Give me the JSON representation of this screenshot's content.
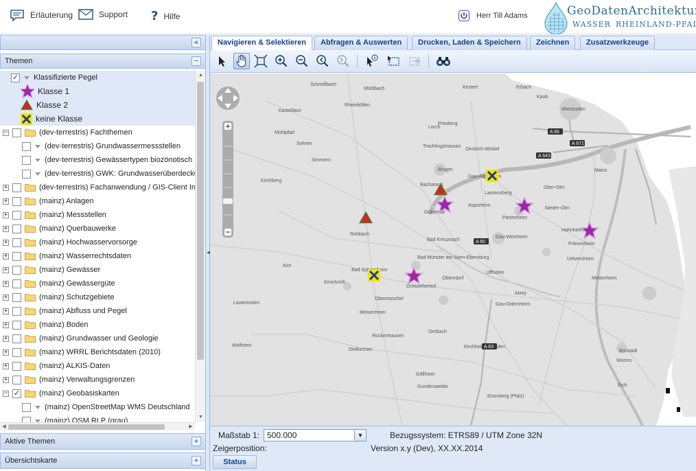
{
  "header": {
    "links": [
      {
        "label": "Erläuterung",
        "icon": "comment-icon"
      },
      {
        "label": "Support",
        "icon": "mail-icon"
      },
      {
        "label": "Hilfe",
        "icon": "help-icon"
      }
    ],
    "user": "Herr Till Adams",
    "logo": {
      "line1": "GeoDatenArchitektur",
      "line2": "Wasser",
      "line3": "Rheinland-Pfalz"
    }
  },
  "left": {
    "collapse_glyph": "«",
    "themes_title": "Themen",
    "themes_tool": "−",
    "active_title": "Aktive Themen",
    "overview_title": "Übersichtskarte",
    "expand_glyph": "+"
  },
  "tree": [
    {
      "label": "Klassifizierte Pegel",
      "checked": true
    },
    {
      "label": "Klasse 1"
    },
    {
      "label": "Klasse 2"
    },
    {
      "label": "keine Klasse"
    },
    {
      "label": "(dev-terrestris) Fachthemen"
    },
    {
      "label": "(dev-terrestris) Grundwassermessstellen"
    },
    {
      "label": "(dev-terrestris) Gewässertypen biozönotisch"
    },
    {
      "label": "(dev-terrestris) GWK: Grundwasserüberdeckung"
    },
    {
      "label": "(dev-terrestris) Fachanwendung / GIS-Client Int"
    },
    {
      "label": "(mainz) Anlagen"
    },
    {
      "label": "(mainz) Messstellen"
    },
    {
      "label": "(mainz) Querbauwerke"
    },
    {
      "label": "(mainz) Hochwasservorsorge"
    },
    {
      "label": "(mainz) Wasserrechtsdaten"
    },
    {
      "label": "(mainz) Gewässer"
    },
    {
      "label": "(mainz) Gewässergüte"
    },
    {
      "label": "(mainz) Schutzgebiete"
    },
    {
      "label": "(mainz) Abfluss und Pegel"
    },
    {
      "label": "(mainz) Boden"
    },
    {
      "label": "(mainz) Grundwasser und Geologie"
    },
    {
      "label": "(mainz) WRRL Berichtsdaten (2010)"
    },
    {
      "label": "(mainz) ALKIS-Daten"
    },
    {
      "label": "(mainz) Verwaltungsgrenzen"
    },
    {
      "label": "(mainz) Geobasiskarten",
      "checked": true
    },
    {
      "label": "(mainz) OpenStreetMap WMS Deutschland"
    },
    {
      "label": "(mainz) OSM RLP (grau)"
    }
  ],
  "tabs": [
    {
      "label": "Navigieren & Selektieren",
      "active": true
    },
    {
      "label": "Abfragen & Auswerten"
    },
    {
      "label": "Drucken, Laden & Speichern"
    },
    {
      "label": "Zeichnen"
    },
    {
      "label": "Zusatzwerkzeuge"
    }
  ],
  "map": {
    "places": [
      "Schnellbach",
      "Mühlbach",
      "Kestert",
      "Erbach",
      "Kaub",
      "Kastellaun",
      "Rheinböllen",
      "Lorch",
      "Presberg",
      "Wiesbaden",
      "Mühlpfad",
      "Sohren",
      "Simmern",
      "Trechtingshausen",
      "Oestrich-Winkel",
      "Mainz",
      "Kirchberg",
      "Bingen",
      "Gau-Algesheim",
      "Laurenzberg",
      "Ober-Olm",
      "Nieder-Olm",
      "Bacharach",
      "Guldental",
      "Aspisheim",
      "Partenheim",
      "Hahnheim",
      "Rehbach",
      "Bad Kreuznach",
      "Gau-Weinheim",
      "Friesenheim",
      "Bad Sobernheim",
      "Bad Münster am Stein-Ebernburg",
      "Kirn",
      "Kirschroth",
      "Dreiweiherhof",
      "Uffhofen",
      "Alzey",
      "Oberndorf",
      "Gau-Odernheim",
      "Obermoschel",
      "Meisenheim",
      "Rockenhausen",
      "Gerbach",
      "Kirchheimbolanden",
      "Dielkirchen",
      "Göllheim",
      "Eisenberg (Pfalz)",
      "Worms",
      "Bürstadt",
      "Eich",
      "Uelversheim",
      "Mettenheim",
      "Gundersweiler",
      "Lauterecken",
      "Wolfstein"
    ],
    "highways": [
      "A 66",
      "A 671",
      "A 643",
      "A 63",
      "A 60"
    ],
    "markers": [
      {
        "label": "Klasse 1",
        "icon": "purple-star-icon",
        "count": 4
      },
      {
        "label": "Klasse 2",
        "icon": "red-triangle-icon",
        "count": 2
      },
      {
        "label": "keine Klasse",
        "icon": "blue-x-icon",
        "count": 2
      }
    ]
  },
  "status": {
    "scale_label": "Maßstab 1:",
    "scale_value": "500.000",
    "crs": "Bezugssystem: ETRS89 / UTM Zone 32N",
    "pointer_label": "Zeigerposition:",
    "version": "Version x.y (Dev), XX.XX.2014",
    "status_button": "Status"
  },
  "colors": {
    "accent": "#15428b",
    "panel": "#dfe8f6",
    "border": "#99bbe8"
  }
}
